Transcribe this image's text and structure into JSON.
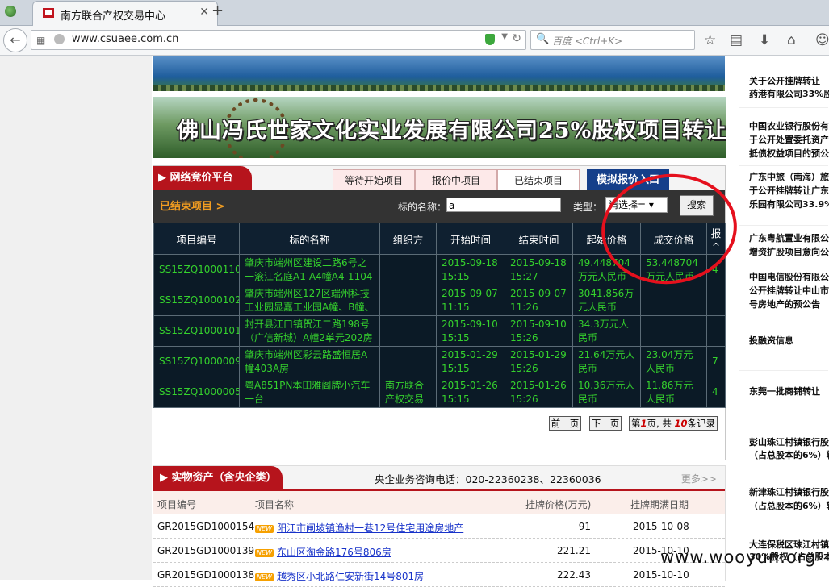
{
  "browser": {
    "tab_title": "南方联合产权交易中心",
    "url": "www.csuaee.com.cn",
    "search_placeholder": "百度 <Ctrl+K>"
  },
  "banner": {
    "title": "佛山冯氏世家文化实业发展有限公司25%股权项目转让"
  },
  "bidding": {
    "section_label": "网络竞价平台",
    "tabs": [
      "等待开始项目",
      "报价中项目",
      "已结束项目",
      "模拟报价入口"
    ],
    "active_tab": "已结束项目",
    "filter": {
      "ended_label": "已结束项目 >",
      "name_label": "标的名称：",
      "name_value": "a",
      "type_label": "类型：",
      "type_value": "请选择=",
      "search_button": "搜索"
    },
    "columns": [
      "项目编号",
      "标的名称",
      "组织方",
      "开始时间",
      "结束时间",
      "起始价格",
      "成交价格",
      "报^"
    ],
    "rows": [
      {
        "id": "SS15ZQ1000110",
        "name": "肇庆市端州区建设二路6号之一滚江名庭A1-A4幢A4-1104",
        "org": "",
        "start": "2015-09-18 15:15",
        "end": "2015-09-18 15:27",
        "start_price": "49.448704万元人民币",
        "deal_price": "53.448704万元人民币",
        "bids": "4"
      },
      {
        "id": "SS15ZQ1000102",
        "name": "肇庆市端州区127区端州科技工业园显嘉工业园A幢、B幢、",
        "org": "",
        "start": "2015-09-07 11:15",
        "end": "2015-09-07 11:26",
        "start_price": "3041.856万元人民币",
        "deal_price": "",
        "bids": ""
      },
      {
        "id": "SS15ZQ1000101",
        "name": "封开县江口镇贺江二路198号（广信新城）A幢2单元202房",
        "org": "",
        "start": "2015-09-10 15:15",
        "end": "2015-09-10 15:26",
        "start_price": "34.3万元人民币",
        "deal_price": "",
        "bids": ""
      },
      {
        "id": "SS15ZQ1000009",
        "name": "肇庆市端州区彩云路盛恒居A幢403A房",
        "org": "",
        "start": "2015-01-29 15:15",
        "end": "2015-01-29 15:26",
        "start_price": "21.64万元人民币",
        "deal_price": "23.04万元人民币",
        "bids": "7"
      },
      {
        "id": "SS15ZQ1000005",
        "name": "粤A851PN本田雅阁牌小汽车一台",
        "org": "南方联合产权交易",
        "start": "2015-01-26 15:15",
        "end": "2015-01-26 15:26",
        "start_price": "10.36万元人民币",
        "deal_price": "11.86万元人民币",
        "bids": "4"
      }
    ],
    "pager": {
      "prev": "前一页",
      "next": "下一页",
      "page_prefix": "第",
      "page_no": "1",
      "page_mid": "页, 共",
      "total": "10",
      "total_suffix": "条记录"
    }
  },
  "assets": {
    "section_label": "实物资产（含央企类）",
    "hotline": "央企业务咨询电话：020-22360238、22360036",
    "more": "更多>>",
    "columns": [
      "项目编号",
      "项目名称",
      "挂牌价格(万元)",
      "挂牌期满日期"
    ],
    "new_badge": "NEW",
    "rows": [
      {
        "id": "GR2015GD1000154",
        "name": "阳江市闸坡镇渔村一巷12号住宅用途房地产",
        "price": "91",
        "date": "2015-10-08"
      },
      {
        "id": "GR2015GD1000139",
        "name": "东山区淘金路176号806房",
        "price": "221.21",
        "date": "2015-10-10"
      },
      {
        "id": "GR2015GD1000138",
        "name": "越秀区小北路仁安新街14号801房",
        "price": "222.43",
        "date": "2015-10-10"
      }
    ]
  },
  "sidebar_news": [
    "关于公开挂牌转让",
    "药港有限公司33%股",
    "中国农业银行股份有",
    "于公开处置委托资产",
    "抵债权益项目的预公",
    "广东中旅（南海）旅",
    "于公开挂牌转让广东",
    "乐园有限公司33.9%",
    "广东粤航置业有限公",
    "增资扩股项目意向公",
    "中国电信股份有限公",
    "公开挂牌转让中山市",
    "号房地产的预公告",
    "投融资信息",
    "东莞一批商铺转让",
    "彭山珠江村镇银行股",
    "（占总股本的6%）转",
    "新津珠江村镇银行股",
    "（占总股本的6%）转",
    "大连保税区珠江村镇",
    "30%股权（占总股本"
  ],
  "watermark": "www.wooyun.org"
}
